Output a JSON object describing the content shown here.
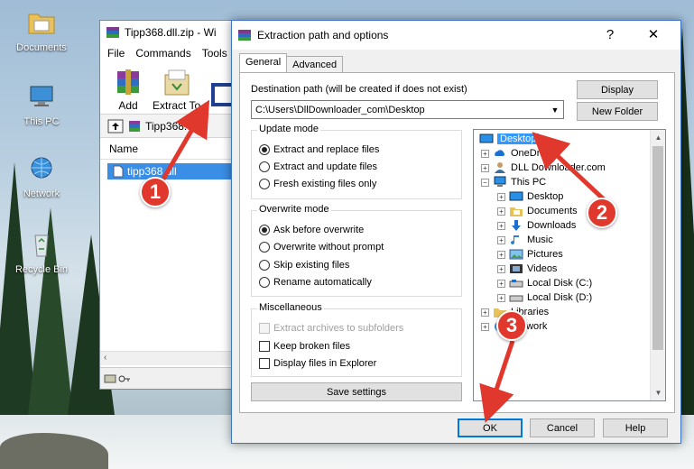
{
  "desktop": {
    "icons": [
      {
        "label": "Documents",
        "icon": "folder-icon"
      },
      {
        "label": "This PC",
        "icon": "computer-icon"
      },
      {
        "label": "Network",
        "icon": "network-icon"
      },
      {
        "label": "Recycle Bin",
        "icon": "recycle-bin-icon"
      }
    ]
  },
  "winrar": {
    "title": "Tipp368.dll.zip - Wi",
    "menu": [
      "File",
      "Commands",
      "Tools"
    ],
    "toolbar": {
      "add": "Add",
      "extract_to": "Extract To"
    },
    "path": "Tipp368.dll",
    "column_name": "Name",
    "selected_file": "tipp368.dll"
  },
  "dialog": {
    "title": "Extraction path and options",
    "help_glyph": "?",
    "close_glyph": "✕",
    "tabs": [
      "General",
      "Advanced"
    ],
    "dest_label": "Destination path (will be created if does not exist)",
    "dest_value": "C:\\Users\\DllDownloader_com\\Desktop",
    "display_btn": "Display",
    "new_folder_btn": "New Folder",
    "update_mode": {
      "title": "Update mode",
      "options": [
        "Extract and replace files",
        "Extract and update files",
        "Fresh existing files only"
      ],
      "selected": 0
    },
    "overwrite_mode": {
      "title": "Overwrite mode",
      "options": [
        "Ask before overwrite",
        "Overwrite without prompt",
        "Skip existing files",
        "Rename automatically"
      ],
      "selected": 0
    },
    "misc": {
      "title": "Miscellaneous",
      "options": [
        "Extract archives to subfolders",
        "Keep broken files",
        "Display files in Explorer"
      ]
    },
    "save_settings": "Save settings",
    "tree": [
      {
        "label": "Desktop"
      },
      {
        "label": "OneDrive"
      },
      {
        "label": "DLL Downloader.com"
      },
      {
        "label": "This PC"
      },
      {
        "label": "Desktop"
      },
      {
        "label": "Documents"
      },
      {
        "label": "Downloads"
      },
      {
        "label": "Music"
      },
      {
        "label": "Pictures"
      },
      {
        "label": "Videos"
      },
      {
        "label": "Local Disk (C:)"
      },
      {
        "label": "Local Disk (D:)"
      },
      {
        "label": "Libraries"
      },
      {
        "label": "Network"
      }
    ],
    "ok": "OK",
    "cancel": "Cancel",
    "help": "Help"
  },
  "annotations": {
    "step1": "1",
    "step2": "2",
    "step3": "3",
    "color": "#e0382c"
  }
}
